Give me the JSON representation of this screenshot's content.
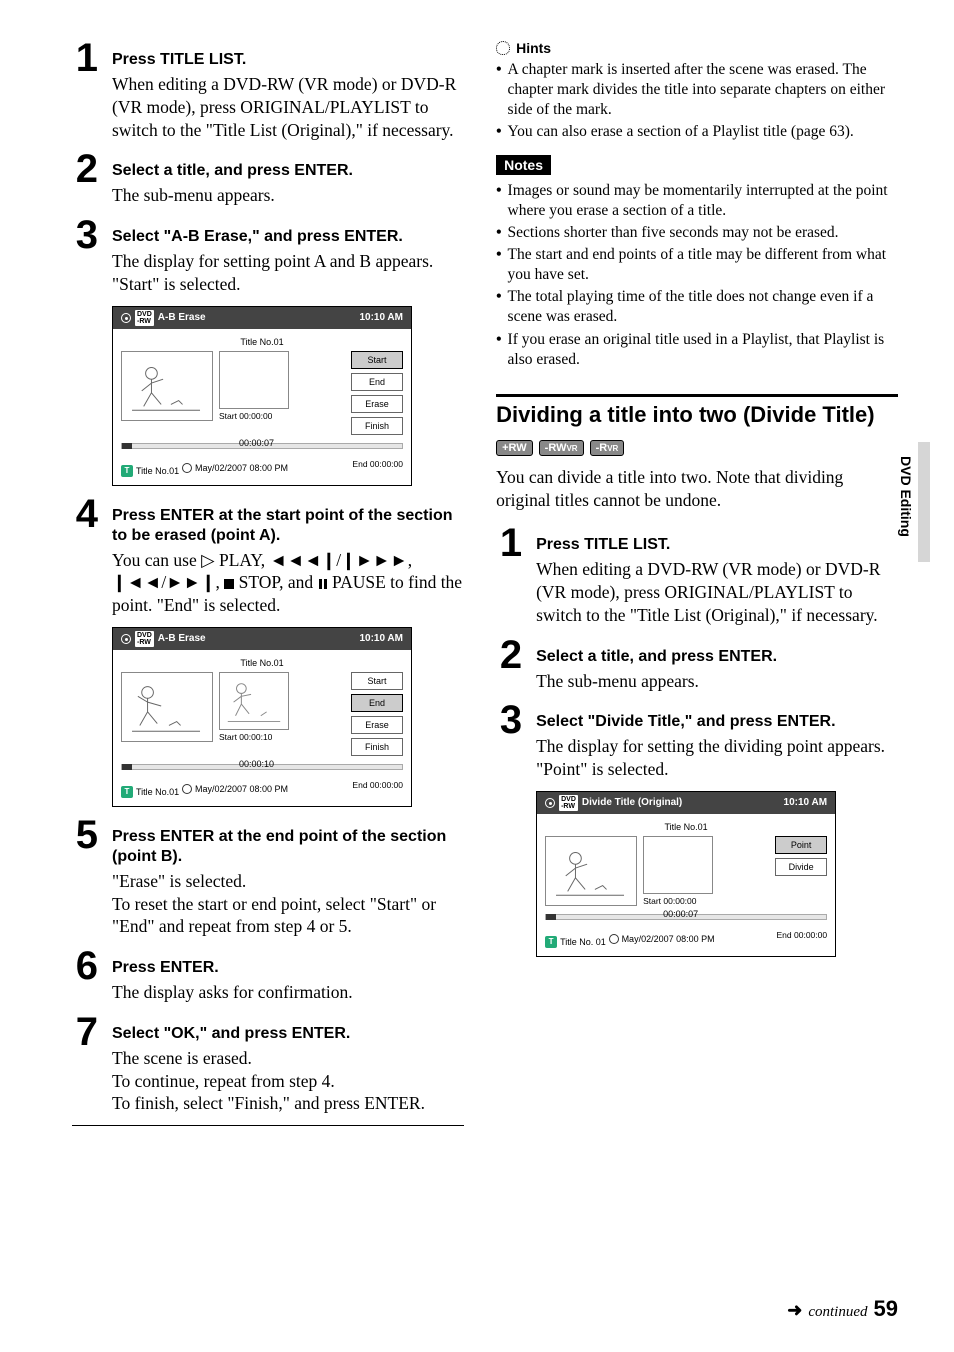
{
  "left": {
    "steps": [
      {
        "num": "1",
        "head": "Press TITLE LIST.",
        "text": "When editing a DVD-RW (VR mode) or DVD-R (VR mode), press ORIGINAL/PLAYLIST to switch to the \"Title List (Original),\" if necessary."
      },
      {
        "num": "2",
        "head": "Select a title, and press ENTER.",
        "text": "The sub-menu appears."
      },
      {
        "num": "3",
        "head": "Select \"A-B Erase,\" and press ENTER.",
        "text": "The display for setting point A and B appears. \"Start\" is selected."
      },
      {
        "num": "4",
        "head": "Press ENTER at the start point of the section to be erased (point A).",
        "text_html": true
      },
      {
        "num": "5",
        "head": "Press ENTER at the end point of the section (point B).",
        "text": "\"Erase\" is selected.\nTo reset the start or end point, select \"Start\" or \"End\" and repeat from step 4 or 5."
      },
      {
        "num": "6",
        "head": "Press ENTER.",
        "text": "The display asks for confirmation."
      },
      {
        "num": "7",
        "head": "Select \"OK,\" and press ENTER.",
        "text": "The scene is erased.\nTo continue, repeat from step 4.\nTo finish, select \"Finish,\" and press ENTER."
      }
    ],
    "step4_parts": {
      "p1": "You can use ",
      "play": " PLAY, ",
      "mid": ", ",
      "stop": " STOP, and ",
      "pause": " PAUSE to find the point. \"End\" is selected."
    },
    "ss1": {
      "header_title": "A-B Erase",
      "header_time": "10:10 AM",
      "title_no": "Title No.01",
      "start_time": "Start 00:00:00",
      "bar_time": "00:00:07",
      "title_badge": "Title No.01",
      "date": "May/02/2007  08:00  PM",
      "end_time": "End   00:00:00",
      "btns": [
        "Start",
        "End",
        "Erase",
        "Finish"
      ],
      "highlight": 0
    },
    "ss2": {
      "header_title": "A-B Erase",
      "header_time": "10:10 AM",
      "title_no": "Title No.01",
      "start_time": "Start 00:00:10",
      "bar_time": "00:00:10",
      "title_badge": "Title No.01",
      "date": "May/02/2007  08:00  PM",
      "end_time": "End   00:00:00",
      "btns": [
        "Start",
        "End",
        "Erase",
        "Finish"
      ],
      "highlight": 1
    }
  },
  "right": {
    "hints_label": "Hints",
    "hints": [
      "A chapter mark is inserted after the scene was erased. The chapter mark divides the title into separate chapters on either side of the mark.",
      "You can also erase a section of a Playlist title (page 63)."
    ],
    "notes_label": "Notes",
    "notes": [
      "Images or sound may be momentarily interrupted at the point where you erase a section of a title.",
      "Sections shorter than five seconds may not be erased.",
      "The start and end points of a title may be different from what you have set.",
      "The total playing time of the title does not change even if a scene was erased.",
      "If you erase an original title used in a Playlist, that Playlist is also erased."
    ],
    "section_heading": "Dividing a title into two (Divide Title)",
    "badges": [
      "+RW",
      "-RWVR",
      "-RVR"
    ],
    "section_intro": "You can divide a title into two. Note that dividing original titles cannot be undone.",
    "steps": [
      {
        "num": "1",
        "head": "Press TITLE LIST.",
        "text": "When editing a DVD-RW (VR mode) or DVD-R (VR mode), press ORIGINAL/PLAYLIST to switch to the \"Title List (Original),\" if necessary."
      },
      {
        "num": "2",
        "head": "Select a title, and press ENTER.",
        "text": "The sub-menu appears."
      },
      {
        "num": "3",
        "head": "Select \"Divide Title,\" and press ENTER.",
        "text": "The display for setting the dividing point appears.\n\"Point\" is selected."
      }
    ],
    "ss3": {
      "header_title": "Divide Title (Original)",
      "header_time": "10:10 AM",
      "title_no": "Title No.01",
      "start_time": "Start 00:00:00",
      "bar_time": "00:00:07",
      "title_badge": "Title No. 01",
      "date": "May/02/2007  08:00  PM",
      "end_time": "End   00:00:00",
      "btns": [
        "Point",
        "Divide"
      ],
      "highlight": 0
    }
  },
  "side_tab": "DVD Editing",
  "footer": {
    "continued": "continued",
    "page": "59"
  }
}
